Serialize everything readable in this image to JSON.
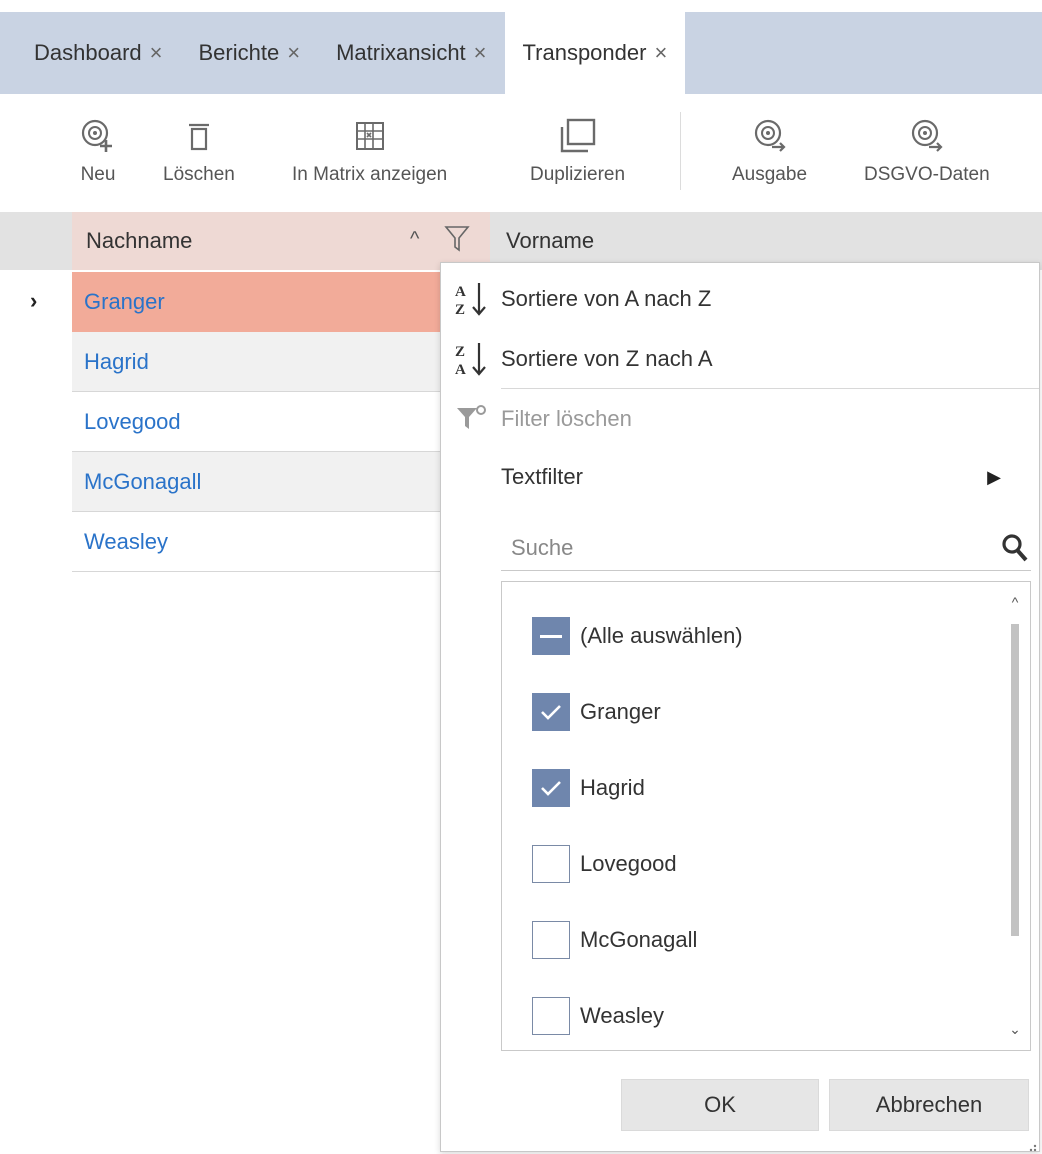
{
  "tabs": [
    {
      "label": "Dashboard",
      "close": "×"
    },
    {
      "label": "Berichte",
      "close": "×"
    },
    {
      "label": "Matrixansicht",
      "close": "×"
    },
    {
      "label": "Transponder",
      "close": "×",
      "active": true
    }
  ],
  "toolbar": {
    "new_label": "Neu",
    "delete_label": "Löschen",
    "matrix_label": "In Matrix anzeigen",
    "duplicate_label": "Duplizieren",
    "output_label": "Ausgabe",
    "gdpr_label": "DSGVO-Daten"
  },
  "grid": {
    "col_nachname": "Nachname",
    "col_vorname": "Vorname",
    "sort_caret": "^",
    "row_indicator": "›",
    "rows": [
      "Granger",
      "Hagrid",
      "Lovegood",
      "McGonagall",
      "Weasley"
    ]
  },
  "popup": {
    "sort_asc": "Sortiere von A nach Z",
    "sort_desc": "Sortiere von Z nach A",
    "clear_filter": "Filter löschen",
    "text_filter": "Textfilter",
    "submenu_arrow": "▶",
    "search_placeholder": "Suche",
    "select_all": "(Alle auswählen)",
    "items": [
      {
        "label": "Granger",
        "checked": true
      },
      {
        "label": "Hagrid",
        "checked": true
      },
      {
        "label": "Lovegood",
        "checked": false
      },
      {
        "label": "McGonagall",
        "checked": false
      },
      {
        "label": "Weasley",
        "checked": false
      }
    ],
    "ok_label": "OK",
    "cancel_label": "Abbrechen",
    "scroll_up": "^",
    "scroll_down": "⌄"
  },
  "colors": {
    "tabbar_bg": "#c9d3e3",
    "selected_row": "#f2ab99",
    "header_sorted": "#eed9d4",
    "link_blue": "#2a73c9",
    "checkbox_fill": "#6f86ad"
  },
  "icons": [
    "new-transponder-icon",
    "delete-icon",
    "matrix-icon",
    "duplicate-icon",
    "output-icon",
    "gdpr-icon",
    "filter-icon",
    "sort-az-icon",
    "sort-za-icon",
    "clear-filter-icon",
    "search-icon",
    "check-icon"
  ]
}
